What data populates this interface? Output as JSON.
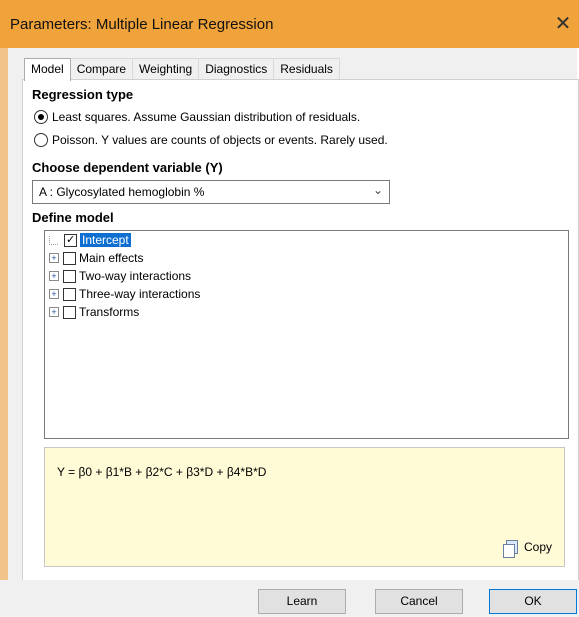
{
  "window": {
    "title": "Parameters: Multiple Linear Regression",
    "close_icon": "✕"
  },
  "tabs": [
    {
      "label": "Model",
      "active": true
    },
    {
      "label": "Compare"
    },
    {
      "label": "Weighting"
    },
    {
      "label": "Diagnostics"
    },
    {
      "label": "Residuals"
    }
  ],
  "regression": {
    "title": "Regression type",
    "options": [
      {
        "label": "Least squares. Assume Gaussian distribution of residuals.",
        "checked": true
      },
      {
        "label": "Poisson. Y values are counts of objects or events. Rarely used.",
        "checked": false
      }
    ]
  },
  "dependent": {
    "title": "Choose dependent variable (Y)",
    "selected": "A : Glycosylated hemoglobin %"
  },
  "model": {
    "title": "Define model",
    "tree": [
      {
        "label": "Intercept",
        "checked": true,
        "selected": true,
        "expandable": false
      },
      {
        "label": "Main effects",
        "checked": false,
        "selected": false,
        "expandable": true
      },
      {
        "label": "Two-way interactions",
        "checked": false,
        "selected": false,
        "expandable": true
      },
      {
        "label": "Three-way interactions",
        "checked": false,
        "selected": false,
        "expandable": true
      },
      {
        "label": "Transforms",
        "checked": false,
        "selected": false,
        "expandable": true
      }
    ]
  },
  "formula": {
    "text": "Y = β0 + β1*B + β2*C + β3*D + β4*B*D",
    "copy_label": "Copy"
  },
  "buttons": {
    "learn": "Learn",
    "cancel": "Cancel",
    "ok": "OK"
  },
  "colors": {
    "titlebar": "#f0a33a",
    "selection": "#0f6fd1",
    "formula_bg": "#fffbd7"
  }
}
